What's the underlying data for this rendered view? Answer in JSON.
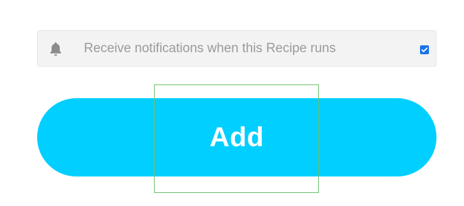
{
  "top_fragment": {
    "text": "",
    "icon": "text-fragment"
  },
  "notifications": {
    "label": "Receive notifications when this Recipe runs",
    "icon": "bell-icon",
    "checked": true,
    "checkbox_color": "#1a73e8"
  },
  "add_button": {
    "label": "Add",
    "color": "#00cfff"
  },
  "colors": {
    "background": "#ffffff",
    "row_background": "#f3f3f3",
    "label_text": "#9a9a9a",
    "focus_outline": "#6cc26a"
  }
}
